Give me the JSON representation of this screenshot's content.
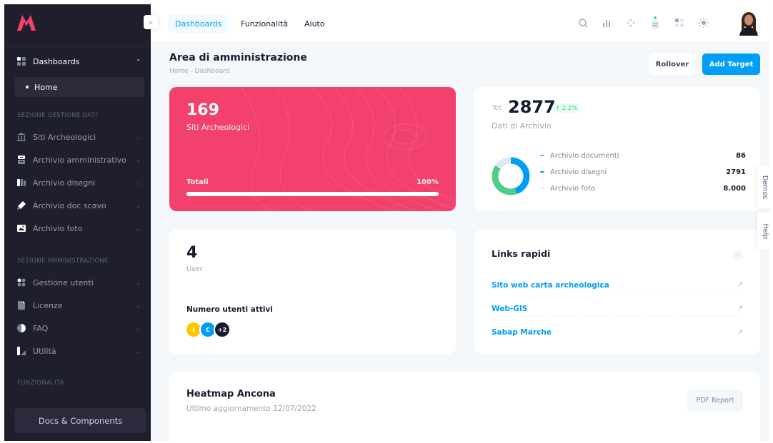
{
  "sidebar": {
    "logo_icon": "metronic-m-logo",
    "collapse_icon": "double-chevron-left-icon",
    "dashboards": {
      "label": "Dashboards",
      "icon": "grid-icon"
    },
    "home": {
      "label": "Home"
    },
    "section_gestione": "SEZIONE GESTIONE DATI",
    "gestione_items": [
      {
        "label": "Siti Archeologici",
        "icon": "temple-icon"
      },
      {
        "label": "Archivio amministrativo",
        "icon": "archive-icon"
      },
      {
        "label": "Archivio disegni",
        "icon": "drawing-icon"
      },
      {
        "label": "Archivio doc scavo",
        "icon": "pen-icon"
      },
      {
        "label": "Archivio foto",
        "icon": "photo-icon"
      }
    ],
    "section_amministrazione": "SEZIONE AMMINISTRAZIONE",
    "admin_items": [
      {
        "label": "Gestione utenti",
        "icon": "users-icon"
      },
      {
        "label": "Licenze",
        "icon": "document-icon"
      },
      {
        "label": "FAQ",
        "icon": "faq-icon"
      },
      {
        "label": "Utilità",
        "icon": "tools-icon"
      }
    ],
    "section_funzionalita": "FUNZIONALITÀ",
    "docs_button": "Docs & Components"
  },
  "topbar": {
    "tabs": [
      {
        "label": "Dashboards",
        "active": true
      },
      {
        "label": "Funzionalità"
      },
      {
        "label": "Aiuto"
      }
    ],
    "icons": [
      "search-icon",
      "chart-icon",
      "sparkle-icon",
      "notification-icon",
      "apps-icon",
      "sun-icon"
    ],
    "avatar": "user-avatar"
  },
  "page": {
    "title": "Area di amministrazione",
    "breadcrumb": "Home - Dashboard",
    "rollover_button": "Rollover",
    "add_target_button": "Add Target"
  },
  "siti_card": {
    "value": "169",
    "label": "Siti Archeologici",
    "total_label": "Totali",
    "total_pct": "100%",
    "progress": 1.0,
    "color": "#f1416c"
  },
  "archivio_card": {
    "tot_prefix": "Tot",
    "value": "2877",
    "delta": "↑ 2.2%",
    "label": "Dati di Archivio",
    "legend": [
      {
        "label": "Archivio documenti",
        "value": "86",
        "color": "#50cd89"
      },
      {
        "label": "Archivio disegni",
        "value": "2791",
        "color": "#009ef7"
      },
      {
        "label": "Archivio foto",
        "value": "8.000",
        "color": "#e4e6ef"
      }
    ]
  },
  "users_card": {
    "value": "4",
    "label": "User",
    "active_label": "Numero utenti attivi",
    "avatars": [
      {
        "text": "I",
        "color": "#ffc700"
      },
      {
        "text": "C",
        "color": "#009ef7"
      },
      {
        "text": "+2",
        "color": "#181c32"
      }
    ]
  },
  "links_card": {
    "title": "Links rapidi",
    "menu_icon": "dots-icon",
    "links": [
      {
        "label": "Sito web carta archeologica"
      },
      {
        "label": "Web-GIS"
      },
      {
        "label": "Sabap Marche"
      }
    ]
  },
  "heatmap_card": {
    "title": "Heatmap Ancona",
    "subtitle": "Ultimo aggiornamento 12/07/2022",
    "pdf_button": "PDF Report"
  },
  "side_tabs": {
    "demos": "Demos",
    "help": "Help"
  }
}
